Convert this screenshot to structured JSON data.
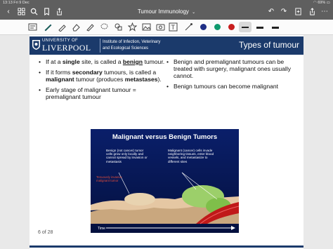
{
  "status": {
    "time": "13:13  Fri 9 Dec",
    "battery": "69%"
  },
  "app": {
    "title": "Tumour Immunology",
    "title_chevron": "⌄"
  },
  "toolbar": {
    "colors": [
      "#1f2f86",
      "#0f9a6e",
      "#c81e1e"
    ]
  },
  "slide": {
    "logo_top": "UNIVERSITY OF",
    "logo_main": "LIVERPOOL",
    "institute_line1": "Institute of Infection, Veterinary",
    "institute_line2": "and Ecological Sciences",
    "title": "Types of tumour",
    "left_bullets": {
      "b1_a": "If at a ",
      "b1_bold": "single",
      "b1_b": " site, is called a",
      "b1_bold2": "benign",
      "b1_c": " tumour.",
      "b2_a": "If it forms ",
      "b2_bold": "secondary",
      "b2_b": " tumours, is called a ",
      "b2_bold2": "malignant",
      "b2_c": " tumour (produces ",
      "b2_bold3": "metastases",
      "b2_d": ").",
      "b3": "Early stage of malignant tumour = premalignant tumour"
    },
    "right_bullets": {
      "b1": "Benign and premalignant tumours can be treated with surgery, malignant ones usually cannot.",
      "b2": "Benign tumours can become malignant"
    },
    "figure": {
      "title": "Malignant versus Benign Tumors",
      "benign_label": "Benign (not cancer) tumor cells grow only locally and cannot spread by invasion or metastasis",
      "malignant_label": "Malignant (cancer) cells invade neighboring tissues, enter blood vessels, and metastasize to different sites",
      "red_label": "Tenuously invasive malignant tumor",
      "time_label": "Time"
    },
    "page_indicator": "6 of 28"
  }
}
